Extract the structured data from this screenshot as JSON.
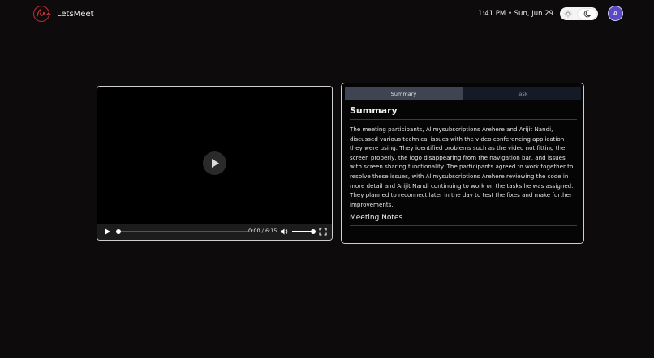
{
  "app": {
    "name": "LetsMeet",
    "datetime": "1:41 PM • Sun, Jun 29",
    "avatar_initial": "A",
    "logo_icon": "signature-logo-icon",
    "theme_toggle": {
      "sun_icon": "sun-icon",
      "moon_icon": "moon-icon",
      "mode": "dark"
    }
  },
  "colors": {
    "background": "#0d0b0b",
    "accent_red": "#7a1f24",
    "avatar": "#5a4bc4",
    "tab_active": "#3e4452",
    "tab_inactive": "#141a26"
  },
  "video": {
    "current_time": "0:00",
    "separator": " / ",
    "duration": "6:15",
    "progress": 0,
    "volume": 1.0,
    "icons": [
      "play-icon",
      "volume-icon",
      "fullscreen-icon"
    ]
  },
  "tabs": [
    {
      "label": "Summary",
      "active": true
    },
    {
      "label": "Task",
      "active": false
    }
  ],
  "summary": {
    "heading": "Summary",
    "text": "The meeting participants, Allmysubscriptions Arehere and Arijit Nandi, discussed various technical issues with the video conferencing application they were using. They identified problems such as the video not fitting the screen properly, the logo disappearing from the navigation bar, and issues with screen sharing functionality. The participants agreed to work together to resolve these issues, with Allmysubscriptions Arehere reviewing the code in more detail and Arijit Nandi continuing to work on the tasks he was assigned. They planned to reconnect later in the day to test the fixes and make further improvements.",
    "notes_heading": "Meeting Notes"
  }
}
